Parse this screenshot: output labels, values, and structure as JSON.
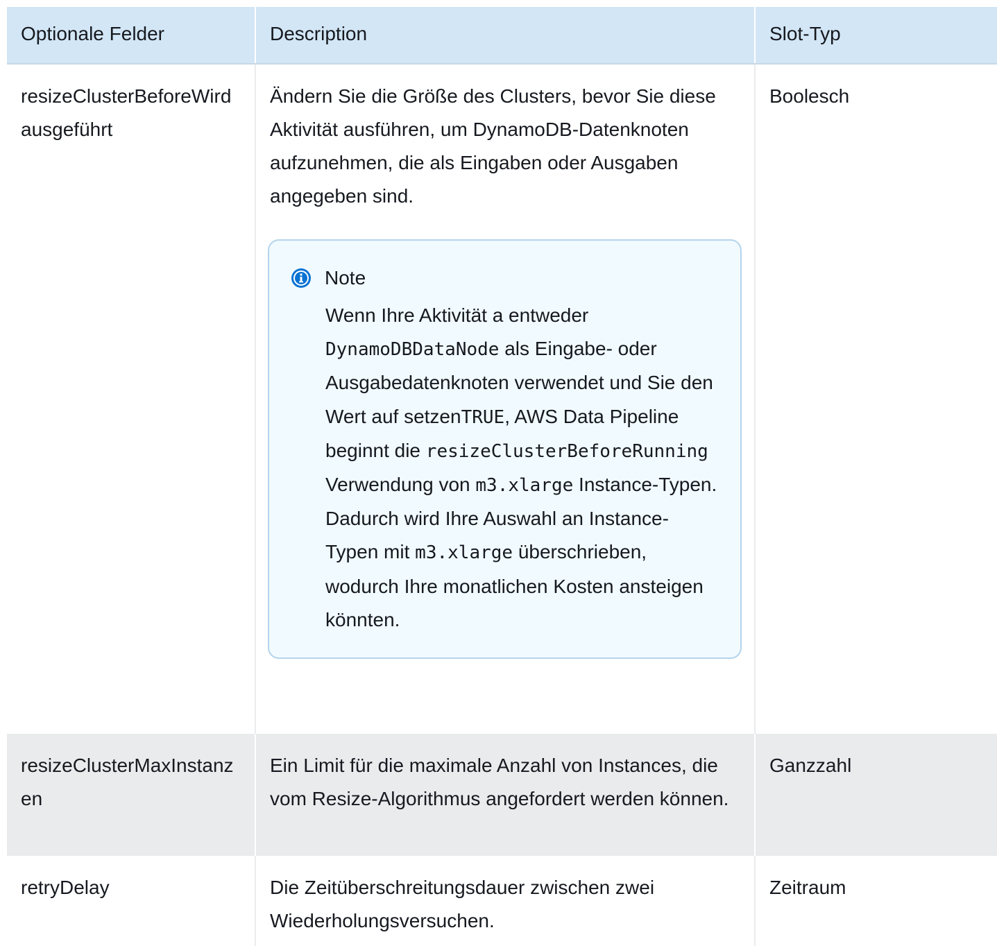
{
  "header": {
    "col1": "Optionale Felder",
    "col2": "Description",
    "col3": "Slot-Typ"
  },
  "rows": [
    {
      "field": "resizeClusterBeforeWird ausgeführt",
      "description": "Ändern Sie die Größe des Clusters, bevor Sie diese Aktivität ausführen, um DynamoDB-Datenknoten aufzunehmen, die als Eingaben oder Ausgaben angegeben sind.",
      "type": "Boolesch",
      "note": {
        "title": "Note",
        "icon": "info-icon",
        "segments": [
          {
            "text": "Wenn Ihre Aktivität a entweder ",
            "code": false
          },
          {
            "text": "DynamoDBDataNode",
            "code": true
          },
          {
            "text": " als Eingabe- oder Ausgabedatenknoten verwendet und Sie den Wert auf setzen",
            "code": false
          },
          {
            "text": "TRUE",
            "code": true
          },
          {
            "text": ", AWS Data Pipeline beginnt die ",
            "code": false
          },
          {
            "text": "resizeClusterBeforeRunning",
            "code": true
          },
          {
            "text": " Verwendung von ",
            "code": false
          },
          {
            "text": "m3.xlarge",
            "code": true
          },
          {
            "text": " Instance-Typen. Dadurch wird Ihre Auswahl an Instance-Typen mit ",
            "code": false
          },
          {
            "text": "m3.xlarge",
            "code": true
          },
          {
            "text": " überschrieben, wodurch Ihre monatlichen Kosten ansteigen könnten.",
            "code": false
          }
        ]
      }
    },
    {
      "field": "resizeClusterMaxInstanzen",
      "description": "Ein Limit für die maximale Anzahl von Instances, die vom Resize-Algorithmus angefordert werden können.",
      "type": "Ganzzahl"
    },
    {
      "field": "retryDelay",
      "description": "Die Zeitüberschreitungsdauer zwischen zwei Wiederholungsversuchen.",
      "type": "Zeitraum"
    }
  ],
  "colors": {
    "header_bg": "#d3e6f6",
    "alt_row_bg": "#e9ebed",
    "note_bg": "#f1faff",
    "note_border": "#b4d4ec",
    "info_icon": "#0972d3",
    "text": "#16191f"
  }
}
